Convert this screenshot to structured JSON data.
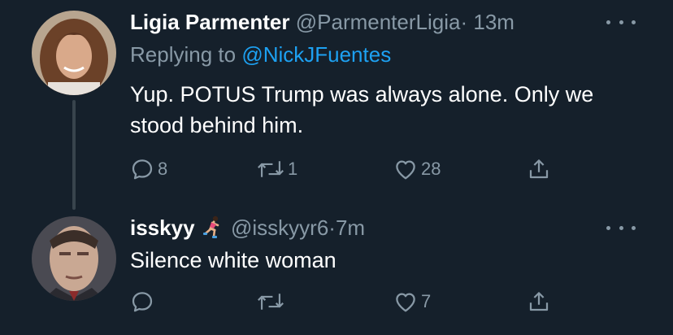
{
  "tweets": [
    {
      "name": "Ligia Parmenter",
      "handle": "@ParmenterLigia",
      "separator": "·",
      "time": "13m",
      "replying_prefix": "Replying to",
      "replying_to": "@NickJFuentes",
      "text": "Yup. POTUS Trump was always alone. Only we stood behind him.",
      "reply_count": "8",
      "retweet_count": "1",
      "like_count": "28"
    },
    {
      "name": "isskyy",
      "name_emoji": "woman-running-emoji",
      "handle": "@isskyyr6",
      "separator": "·",
      "time": "7m",
      "text": "Silence white woman",
      "reply_count": "",
      "retweet_count": "",
      "like_count": "7"
    }
  ],
  "colors": {
    "background": "#15202b",
    "secondary_text": "#8899a6",
    "accent": "#1da1f2",
    "thread_line": "#38444d"
  }
}
